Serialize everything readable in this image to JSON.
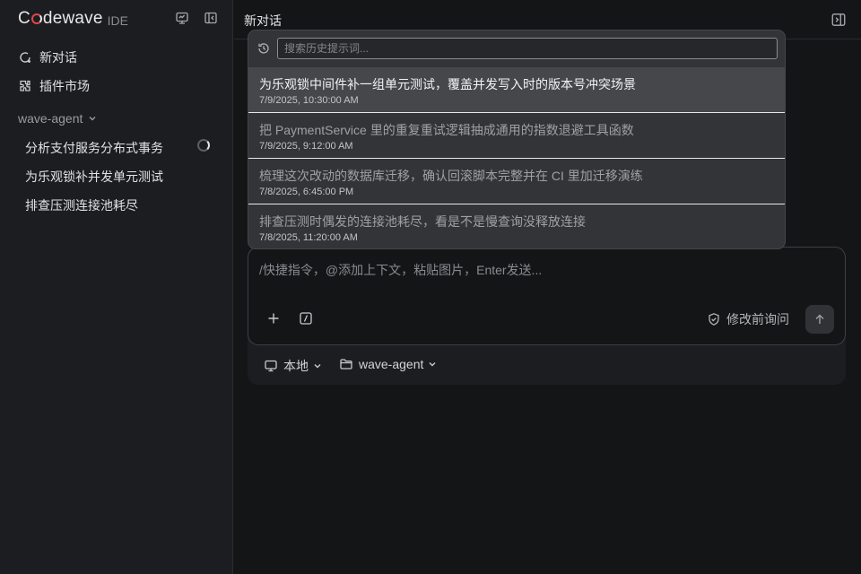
{
  "brand": {
    "name_prefix": "C",
    "name_suffix": "dewave",
    "tag": "IDE"
  },
  "sidebar": {
    "nav": [
      {
        "label": "新对话",
        "icon": "new-chat-icon"
      },
      {
        "label": "插件市场",
        "icon": "plugin-icon"
      }
    ],
    "section": {
      "label": "wave-agent",
      "icon": "chevron-down-icon"
    },
    "conversations": [
      {
        "label": "分析支付服务分布式事务",
        "status": "loading"
      },
      {
        "label": "为乐观锁补并发单元测试"
      },
      {
        "label": "排查压测连接池耗尽"
      }
    ]
  },
  "main": {
    "title": "新对话"
  },
  "history": {
    "placeholder": "搜索历史提示词...",
    "items": [
      {
        "title": "为乐观锁中间件补一组单元测试，覆盖并发写入时的版本号冲突场景",
        "date": "7/9/2025, 10:30:00 AM",
        "active": true
      },
      {
        "title": "把 PaymentService 里的重复重试逻辑抽成通用的指数退避工具函数",
        "date": "7/9/2025, 9:12:00 AM"
      },
      {
        "title": "梳理这次改动的数据库迁移，确认回滚脚本完整并在 CI 里加迁移演练",
        "date": "7/8/2025, 6:45:00 PM"
      },
      {
        "title": "排查压测时偶发的连接池耗尽，看是不是慢查询没释放连接",
        "date": "7/8/2025, 11:20:00 AM"
      }
    ]
  },
  "composer": {
    "placeholder": "/快捷指令，@添加上下文，粘贴图片，Enter发送...",
    "review_label": "修改前询问",
    "env_label": "本地",
    "workspace_label": "wave-agent"
  },
  "colors": {
    "accent": "#e0464c",
    "background": "#141517",
    "sidebar": "#1c1d20"
  }
}
